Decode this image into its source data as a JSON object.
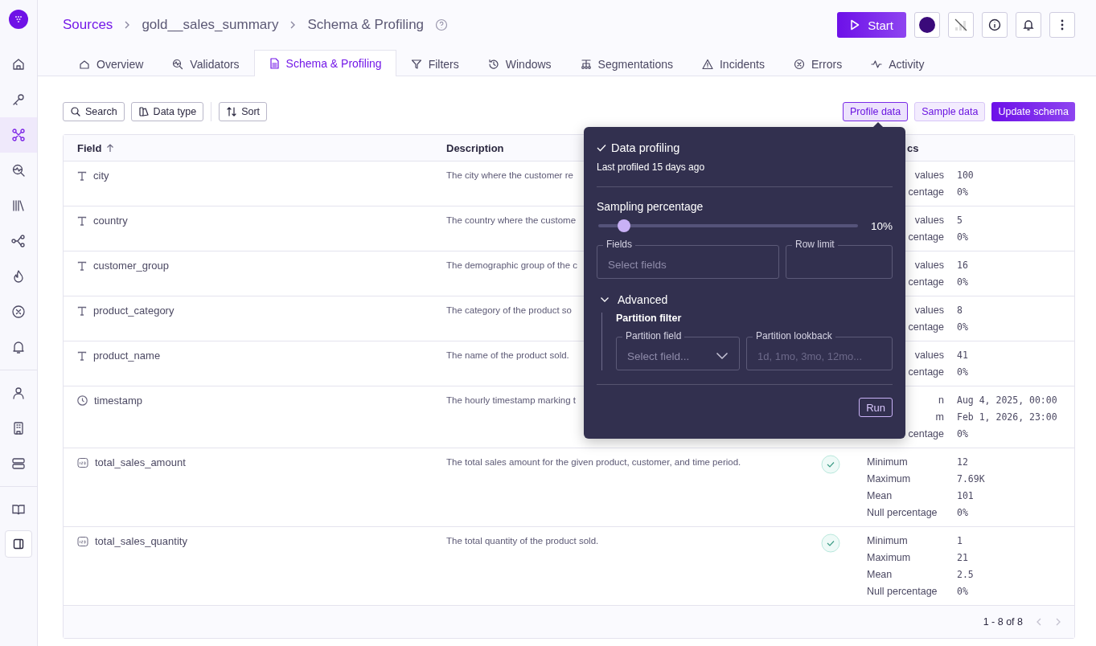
{
  "breadcrumb": [
    {
      "label": "Sources",
      "kind": "link"
    },
    {
      "label": "gold__sales_summary",
      "kind": "crumb"
    },
    {
      "label": "Schema & Profiling",
      "kind": "crumb"
    }
  ],
  "header": {
    "start_label": "Start"
  },
  "sidebar": {
    "items": [
      {
        "selected": false
      },
      {
        "selected": false
      },
      {
        "selected": true
      },
      {
        "selected": false
      },
      {
        "selected": false
      },
      {
        "selected": false
      },
      {
        "selected": false
      },
      {
        "selected": false
      },
      {
        "selected": false
      }
    ],
    "bottom_items": [
      {
        "selected": false
      },
      {
        "selected": false
      },
      {
        "selected": false
      }
    ]
  },
  "tabs": [
    {
      "label": "Overview",
      "selected": false
    },
    {
      "label": "Validators",
      "selected": false
    },
    {
      "label": "Schema & Profiling",
      "selected": true
    },
    {
      "label": "Filters",
      "selected": false
    },
    {
      "label": "Windows",
      "selected": false
    },
    {
      "label": "Segmentations",
      "selected": false
    },
    {
      "label": "Incidents",
      "selected": false
    },
    {
      "label": "Errors",
      "selected": false
    },
    {
      "label": "Activity",
      "selected": false
    }
  ],
  "toolbar": {
    "filters": [
      "Search",
      "Data type",
      "Sort"
    ],
    "actions": [
      {
        "label": "Profile data",
        "kind": "active"
      },
      {
        "label": "Sample data",
        "kind": "soft"
      },
      {
        "label": "Update schema",
        "kind": "primary"
      }
    ]
  },
  "table": {
    "columns": [
      {
        "label": "Field"
      },
      {
        "label": "Description"
      },
      {
        "label": "cs"
      }
    ],
    "rows": [
      {
        "kind": "text",
        "field": "city",
        "description": "The city where the customer re",
        "stats": [
          {
            "label": "values",
            "value": "100",
            "cut": true
          },
          {
            "label": "centage",
            "value": "0%",
            "cut": true
          }
        ]
      },
      {
        "kind": "text",
        "field": "country",
        "description": "The country where the custome",
        "stats": [
          {
            "label": "values",
            "value": "5",
            "cut": true
          },
          {
            "label": "centage",
            "value": "0%",
            "cut": true
          }
        ]
      },
      {
        "kind": "text",
        "field": "customer_group",
        "description": "The demographic group of the c",
        "stats": [
          {
            "label": "values",
            "value": "16",
            "cut": true
          },
          {
            "label": "centage",
            "value": "0%",
            "cut": true
          }
        ]
      },
      {
        "kind": "text",
        "field": "product_category",
        "description": "The category of the product so",
        "stats": [
          {
            "label": "values",
            "value": "8",
            "cut": true
          },
          {
            "label": "centage",
            "value": "0%",
            "cut": true
          }
        ]
      },
      {
        "kind": "text",
        "field": "product_name",
        "description": "The name of the product sold.",
        "stats": [
          {
            "label": "values",
            "value": "41",
            "cut": true
          },
          {
            "label": "centage",
            "value": "0%",
            "cut": true
          }
        ]
      },
      {
        "kind": "time",
        "field": "timestamp",
        "description": "The hourly timestamp marking t",
        "stats": [
          {
            "label": "n",
            "value": "Aug 4, 2025, 00:00",
            "cut": true
          },
          {
            "label": "m",
            "value": "Feb 1, 2026, 23:00",
            "cut": true
          },
          {
            "label": "centage",
            "value": "0%",
            "cut": true
          }
        ]
      },
      {
        "kind": "number",
        "field": "total_sales_amount",
        "description": "The total sales amount for the given product, customer, and time period.",
        "check": true,
        "stats": [
          {
            "label": "Minimum",
            "value": "12",
            "cut": false
          },
          {
            "label": "Maximum",
            "value": "7.69K",
            "cut": false
          },
          {
            "label": "Mean",
            "value": "101",
            "cut": false
          },
          {
            "label": "Null percentage",
            "value": "0%",
            "cut": false
          }
        ]
      },
      {
        "kind": "number",
        "field": "total_sales_quantity",
        "description": "The total quantity of the product sold.",
        "check": true,
        "stats": [
          {
            "label": "Minimum",
            "value": "1",
            "cut": false
          },
          {
            "label": "Maximum",
            "value": "21",
            "cut": false
          },
          {
            "label": "Mean",
            "value": "2.5",
            "cut": false
          },
          {
            "label": "Null percentage",
            "value": "0%",
            "cut": false
          }
        ]
      }
    ],
    "pagination": "1 - 8 of 8"
  },
  "popover": {
    "title": "Data profiling",
    "subtitle": "Last profiled 15 days ago",
    "slider": {
      "label": "Sampling percentage",
      "level": 0.1,
      "reading": "10%"
    },
    "fields": {
      "label": "Fields",
      "placeholder": "Select fields"
    },
    "row_limit": {
      "label": "Row limit"
    },
    "advanced": {
      "label": "Advanced",
      "expanded": true,
      "section": "Partition filter",
      "partition_field": {
        "label": "Partition field",
        "placeholder": "Select field..."
      },
      "partition_lookback": {
        "label": "Partition lookback",
        "placeholder": "1d, 1mo, 3mo, 12mo..."
      }
    },
    "run_label": "Run"
  }
}
